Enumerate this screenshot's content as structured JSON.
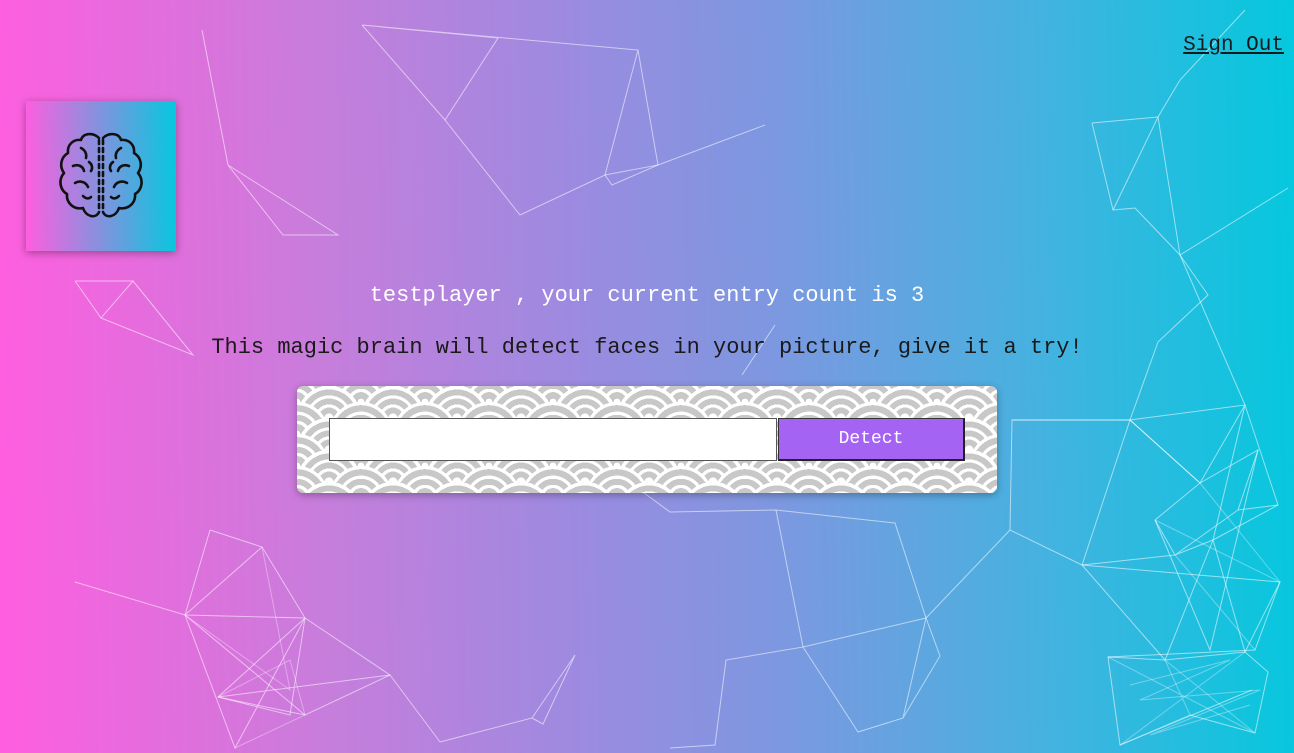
{
  "nav": {
    "sign_out_label": "Sign Out"
  },
  "logo": {
    "icon": "brain-icon"
  },
  "rank": {
    "user_name": "testplayer",
    "message_before_count": " , your current entry count is ",
    "entry_count": "3"
  },
  "form": {
    "tagline": "This magic brain will detect faces in your picture, give it a try!",
    "input_value": "",
    "detect_label": "Detect"
  },
  "colors": {
    "gradient_start": "#ff5edf",
    "gradient_end": "#04c8de",
    "detect_button": "#a463f2"
  }
}
